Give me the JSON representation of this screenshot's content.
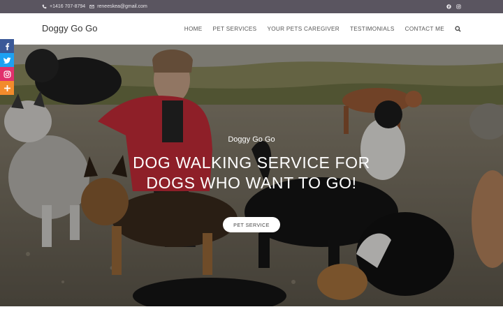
{
  "topbar": {
    "phone": "+1416 707-8794",
    "email": "reneeskea@gmail.com",
    "social_icons": [
      "facebook-icon",
      "instagram-icon"
    ]
  },
  "header": {
    "logo": "Doggy Go Go",
    "nav": [
      "HOME",
      "PET SERVICES",
      "YOUR PETS CAREGIVER",
      "TESTIMONIALS",
      "CONTACT ME"
    ],
    "search_icon": "search-icon"
  },
  "hero": {
    "subtitle": "Doggy Go Go",
    "headline_line1": "DOG WALKING SERVICE FOR",
    "headline_line2": "DOGS WHO WANT TO GO!",
    "cta": "PET SERVICE"
  },
  "share": {
    "buttons": [
      {
        "icon": "facebook-icon",
        "color": "#3b5998"
      },
      {
        "icon": "twitter-icon",
        "color": "#1da1f2"
      },
      {
        "icon": "instagram-icon",
        "color": "#e1306c"
      },
      {
        "icon": "plus-icon",
        "color": "#f28b2c"
      }
    ]
  },
  "colors": {
    "topbar": "#5a5560",
    "accent": "#ffffff"
  }
}
